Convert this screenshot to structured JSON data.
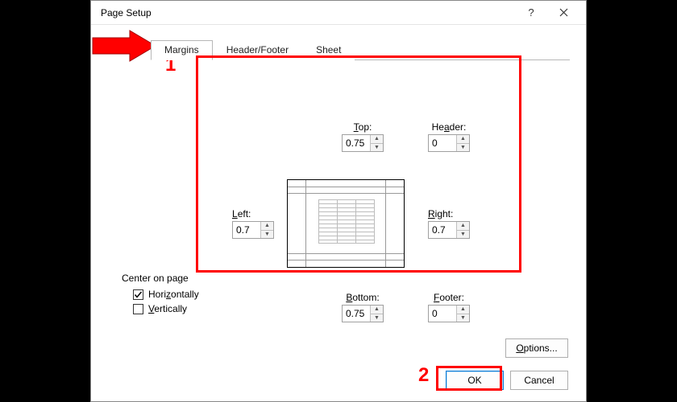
{
  "titlebar": {
    "title": "Page Setup"
  },
  "tabs": {
    "margins": "Margins",
    "header_footer": "Header/Footer",
    "sheet": "Sheet"
  },
  "margins": {
    "top_label": "Top:",
    "top_value": "0.75",
    "header_label": "Header:",
    "header_value": "0",
    "left_label": "Left:",
    "left_value": "0.7",
    "right_label": "Right:",
    "right_value": "0.7",
    "bottom_label": "Bottom:",
    "bottom_value": "0.75",
    "footer_label": "Footer:",
    "footer_value": "0"
  },
  "center": {
    "group_label": "Center on page",
    "horizontally": "Horizontally",
    "horizontally_checked": true,
    "vertically": "Vertically",
    "vertically_checked": false
  },
  "buttons": {
    "options": "Options...",
    "ok": "OK",
    "cancel": "Cancel"
  },
  "annotations": {
    "step1": "1",
    "step2": "2"
  }
}
